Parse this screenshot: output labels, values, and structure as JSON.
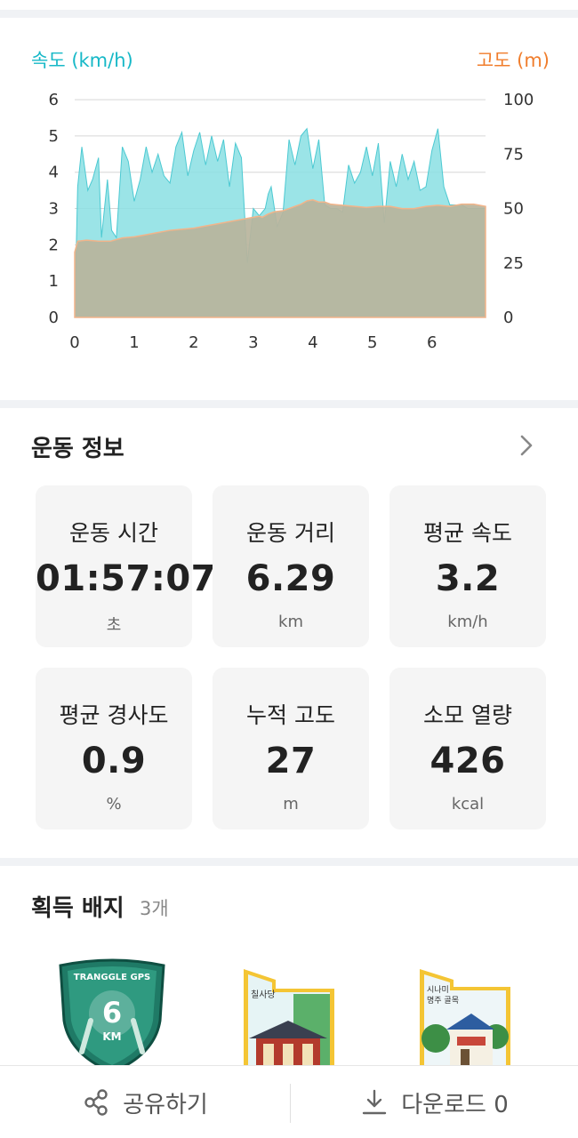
{
  "chart_data": {
    "type": "area",
    "x_ticks": [
      "0",
      "1",
      "2",
      "3",
      "4",
      "5",
      "6"
    ],
    "xlim": [
      0,
      6.9
    ],
    "left_axis": {
      "label": "속도 (km/h)",
      "ticks": [
        "0",
        "1",
        "2",
        "3",
        "4",
        "5",
        "6"
      ],
      "ylim": [
        0,
        6.1
      ],
      "color": "#16b8c7"
    },
    "right_axis": {
      "label": "고도 (m)",
      "ticks": [
        "0",
        "25",
        "50",
        "75",
        "100"
      ],
      "ylim": [
        0,
        101.7
      ],
      "color": "#f07d2c"
    },
    "grid": true,
    "series": [
      {
        "name": "속도 (km/h)",
        "color": "#8adfe3",
        "x": [
          0,
          0.05,
          0.12,
          0.22,
          0.3,
          0.4,
          0.45,
          0.55,
          0.62,
          0.7,
          0.8,
          0.9,
          1.0,
          1.1,
          1.2,
          1.3,
          1.4,
          1.5,
          1.6,
          1.7,
          1.8,
          1.9,
          2.0,
          2.1,
          2.2,
          2.3,
          2.4,
          2.5,
          2.6,
          2.7,
          2.8,
          2.9,
          3.0,
          3.1,
          3.2,
          3.25,
          3.3,
          3.4,
          3.5,
          3.6,
          3.7,
          3.8,
          3.9,
          4.0,
          4.1,
          4.2,
          4.3,
          4.4,
          4.5,
          4.6,
          4.7,
          4.8,
          4.9,
          5.0,
          5.1,
          5.2,
          5.3,
          5.4,
          5.5,
          5.6,
          5.7,
          5.8,
          5.9,
          6.0,
          6.1,
          6.2,
          6.3,
          6.4,
          6.5,
          6.6,
          6.7,
          6.8,
          6.9
        ],
        "values": [
          0,
          3.6,
          4.7,
          3.5,
          3.8,
          4.4,
          2.2,
          3.8,
          2.4,
          2.2,
          4.7,
          4.3,
          3.2,
          3.8,
          4.7,
          4.0,
          4.5,
          3.9,
          3.7,
          4.7,
          5.1,
          3.9,
          4.6,
          5.1,
          4.2,
          5.0,
          4.3,
          4.9,
          3.6,
          4.8,
          4.4,
          1.5,
          3.0,
          2.8,
          3.0,
          3.4,
          3.6,
          2.5,
          2.9,
          4.9,
          4.2,
          5.0,
          5.2,
          4.1,
          4.9,
          3.1,
          3.0,
          3.0,
          2.9,
          4.2,
          3.7,
          4.0,
          4.7,
          3.9,
          4.8,
          2.6,
          4.3,
          3.6,
          4.5,
          3.8,
          4.3,
          3.5,
          3.6,
          4.6,
          5.2,
          3.6,
          3.1,
          3.1,
          3.1,
          3.0,
          3.0,
          3.0,
          3.0
        ]
      },
      {
        "name": "고도 (m)",
        "color": "#b9b49c",
        "x": [
          0,
          0.05,
          0.2,
          0.4,
          0.6,
          0.8,
          1.0,
          1.2,
          1.4,
          1.6,
          1.8,
          2.0,
          2.2,
          2.4,
          2.6,
          2.8,
          3.0,
          3.1,
          3.15,
          3.25,
          3.35,
          3.5,
          3.6,
          3.7,
          3.8,
          3.9,
          4.0,
          4.1,
          4.2,
          4.3,
          4.5,
          4.7,
          4.9,
          5.1,
          5.3,
          5.5,
          5.7,
          5.9,
          6.1,
          6.3,
          6.5,
          6.7,
          6.9
        ],
        "values": [
          30,
          35,
          35.5,
          35,
          35,
          36.5,
          37,
          38,
          39,
          40,
          40.5,
          41,
          42,
          43,
          44,
          45,
          46,
          46.5,
          46,
          47.5,
          48.5,
          49,
          50,
          51,
          52,
          53.5,
          54,
          53,
          53,
          52,
          51.5,
          51,
          50.5,
          51,
          51,
          50,
          50,
          51,
          51.5,
          51,
          52,
          52,
          51
        ]
      }
    ]
  },
  "section_exercise": {
    "title": "운동 정보",
    "stats": [
      {
        "label": "운동 시간",
        "value": "01:57:07",
        "unit": "초"
      },
      {
        "label": "운동 거리",
        "value": "6.29",
        "unit": "km"
      },
      {
        "label": "평균 속도",
        "value": "3.2",
        "unit": "km/h"
      },
      {
        "label": "평균 경사도",
        "value": "0.9",
        "unit": "%"
      },
      {
        "label": "누적 고도",
        "value": "27",
        "unit": "m"
      },
      {
        "label": "소모 열량",
        "value": "426",
        "unit": "kcal"
      }
    ]
  },
  "section_badges": {
    "title": "획득 배지",
    "count": "3개",
    "badges": [
      {
        "name": "tranggle-6km-walking-badge",
        "text_top": "TRANGGLE GPS",
        "text_num": "6",
        "text_unit": "KM"
      },
      {
        "name": "chilsadang-badge",
        "text": "칠사당"
      },
      {
        "name": "sinami-badge",
        "text_line1": "시나미",
        "text_line2": "명주 골목"
      }
    ]
  },
  "bottom_bar": {
    "share_label": "공유하기",
    "download_label": "다운로드 0",
    "share_icon": "share-icon",
    "download_icon": "download-icon"
  }
}
